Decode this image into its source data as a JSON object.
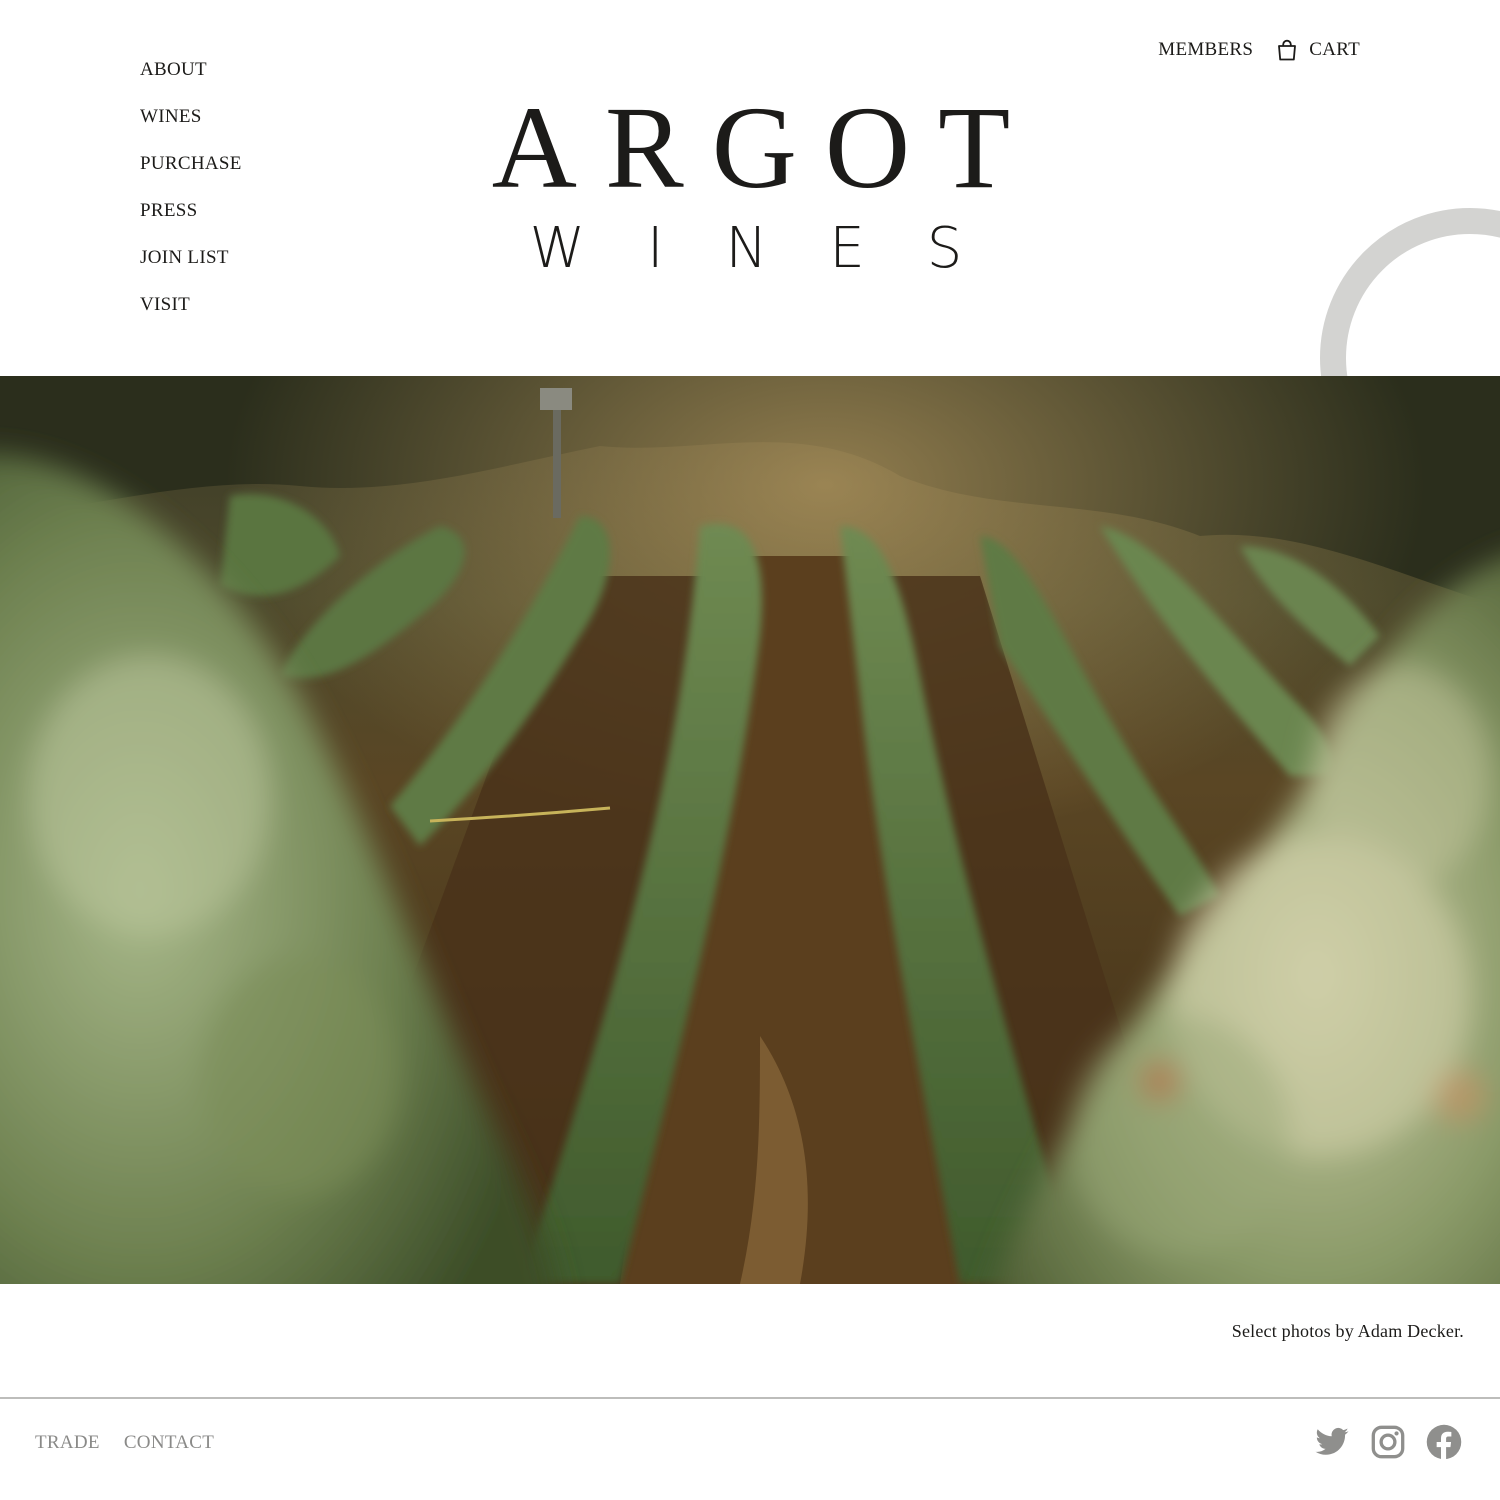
{
  "nav": {
    "items": [
      {
        "label": "ABOUT"
      },
      {
        "label": "WINES"
      },
      {
        "label": "PURCHASE"
      },
      {
        "label": "PRESS"
      },
      {
        "label": "JOIN LIST"
      },
      {
        "label": "VISIT"
      }
    ]
  },
  "utility": {
    "members_label": "MEMBERS",
    "cart_label": "CART",
    "cart_icon": "shopping-bag-icon"
  },
  "logo": {
    "top": "ARGOT",
    "bottom": "WINES"
  },
  "hero": {
    "image": "vineyard rows photograph"
  },
  "caption": "Select photos by Adam Decker.",
  "footer": {
    "links": [
      {
        "label": "TRADE"
      },
      {
        "label": "CONTACT"
      }
    ],
    "social": [
      "twitter-icon",
      "instagram-icon",
      "facebook-icon"
    ]
  },
  "colors": {
    "text": "#1c1b19",
    "muted": "#8a8a88",
    "arc": "#d3d3d1",
    "social": "#8f8f8d"
  }
}
